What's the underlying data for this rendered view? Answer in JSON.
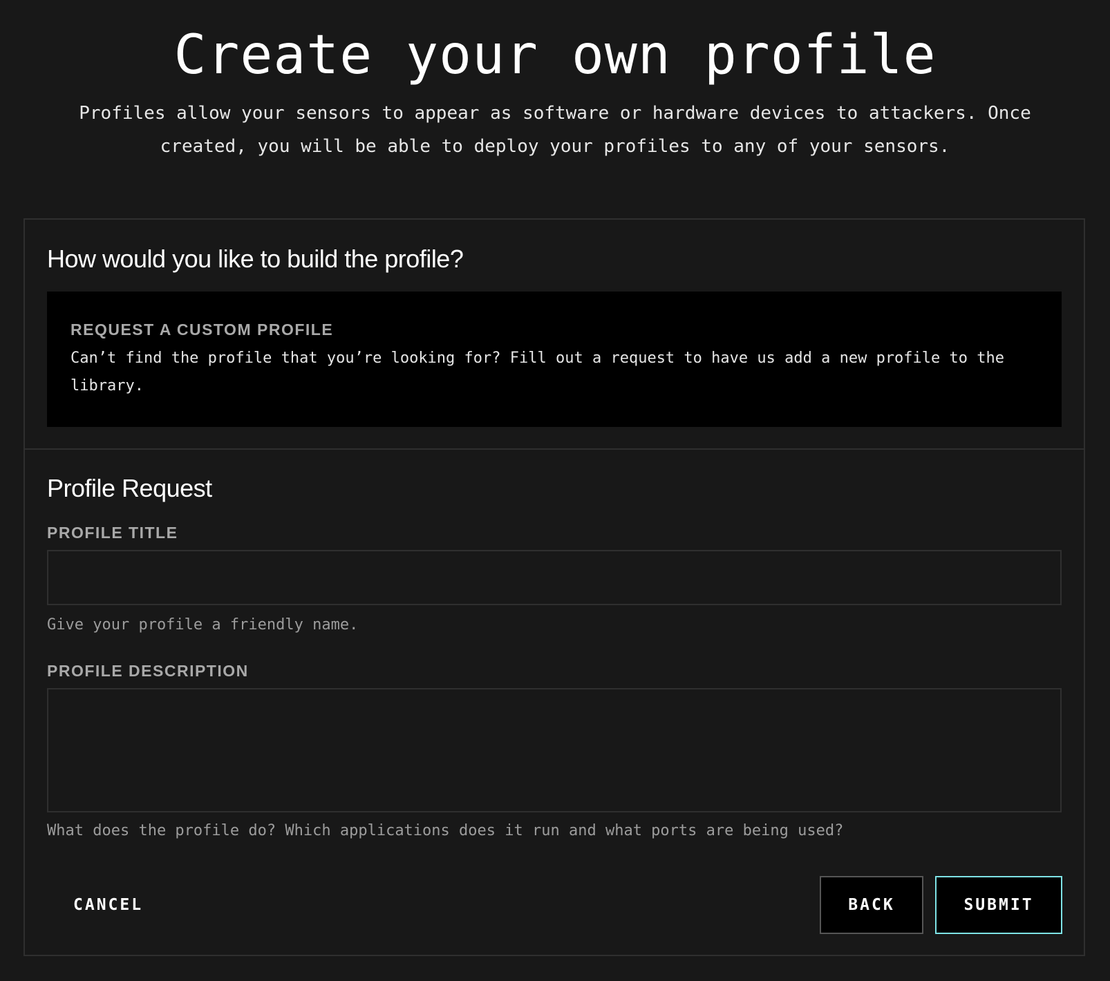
{
  "header": {
    "title": "Create your own profile",
    "subtitle": "Profiles allow your sensors to appear as software or hardware devices to attackers. Once created, you will be able to deploy your profiles to any of your sensors."
  },
  "build_section": {
    "heading": "How would you like to build the profile?",
    "option": {
      "title": "REQUEST A CUSTOM PROFILE",
      "description": "Can’t find the profile that you’re looking for? Fill out a request to have us add a new profile to the library."
    }
  },
  "request_section": {
    "heading": "Profile Request",
    "title_field": {
      "label": "PROFILE TITLE",
      "value": "",
      "placeholder": "",
      "help": "Give your profile a friendly name."
    },
    "description_field": {
      "label": "PROFILE DESCRIPTION",
      "value": "",
      "placeholder": "",
      "help": "What does the profile do? Which applications does it run and what ports are being used?"
    }
  },
  "actions": {
    "cancel_label": "CANCEL",
    "back_label": "BACK",
    "submit_label": "SUBMIT"
  },
  "colors": {
    "background": "#181818",
    "card_border": "#2f2f2f",
    "option_background": "#000000",
    "label": "#a9a9a9",
    "help_text": "#9c9c9c",
    "submit_border": "#7ee3e6"
  }
}
